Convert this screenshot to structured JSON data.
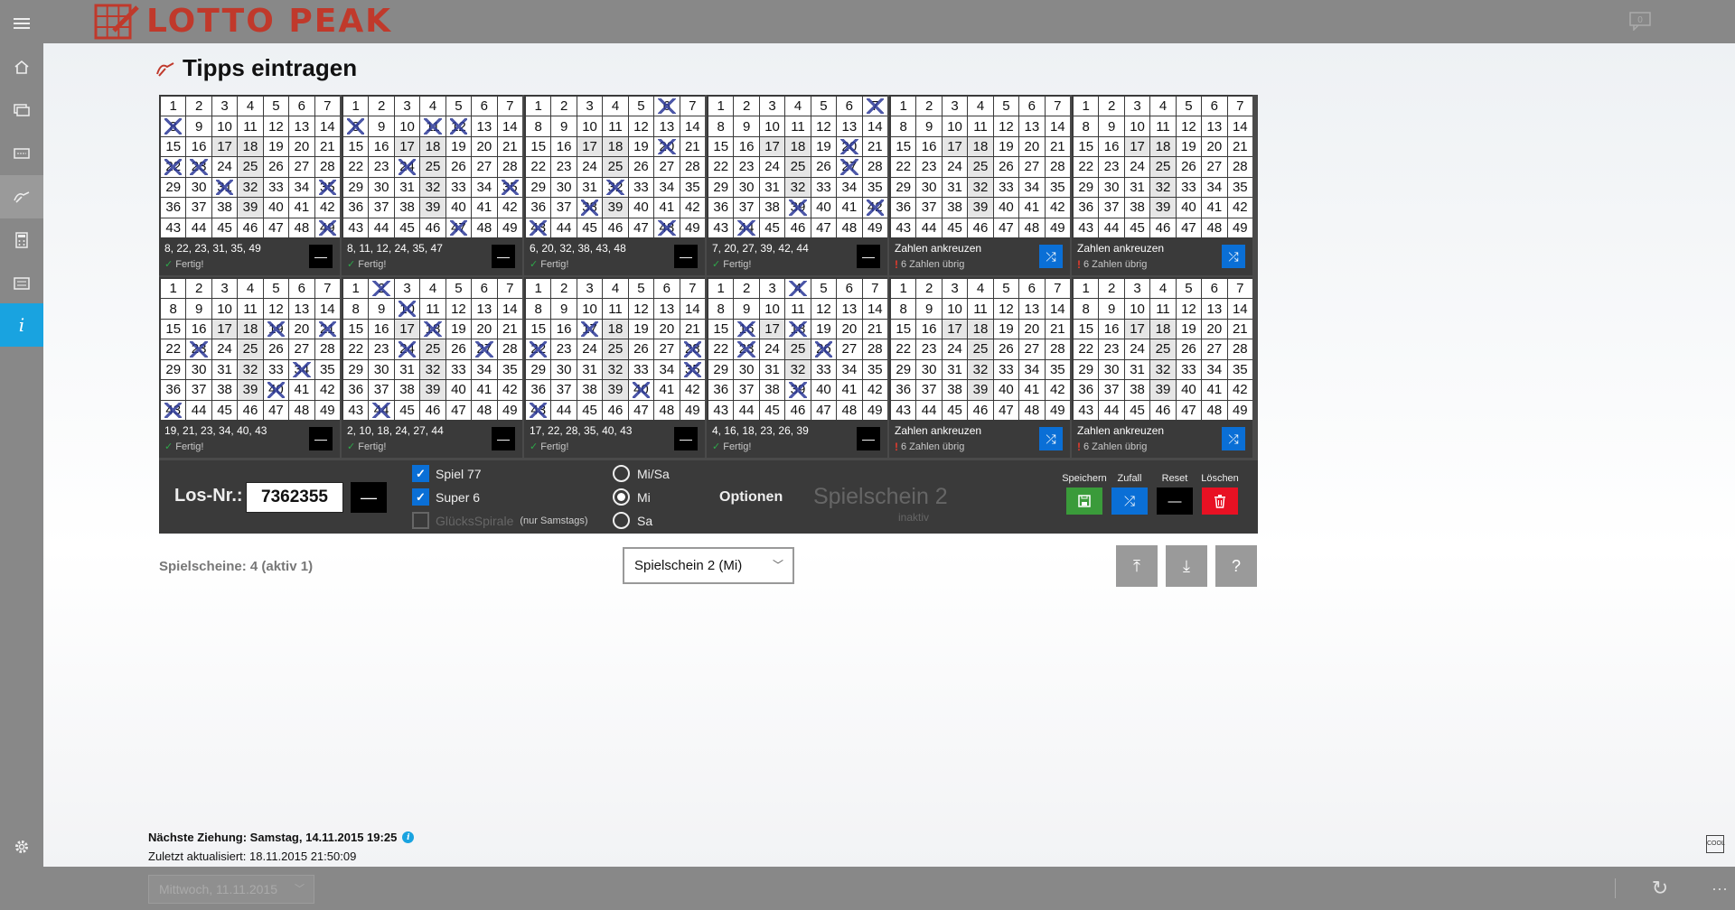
{
  "app": {
    "logo": "LOTTO PEAK",
    "brand_color": "#c0392b",
    "accent_color": "#0a6fd6",
    "info_color": "#19a3e0",
    "message_count": "0"
  },
  "nav": {
    "items": [
      {
        "name": "menu-icon"
      },
      {
        "name": "home-icon"
      },
      {
        "name": "results-icon"
      },
      {
        "name": "ticket-icon"
      },
      {
        "name": "enter-tips-icon",
        "selected": true
      },
      {
        "name": "calculator-icon"
      },
      {
        "name": "statistics-icon"
      },
      {
        "name": "info-icon",
        "active": true
      },
      {
        "name": "settings-icon"
      }
    ]
  },
  "page": {
    "title": "Tipps eintragen"
  },
  "tickets": [
    {
      "numbers": "8, 22, 23, 31, 35, 49",
      "status": "Fertig!",
      "state": "done",
      "picks": [
        8,
        22,
        23,
        31,
        35,
        49
      ]
    },
    {
      "numbers": "8, 11, 12, 24, 35, 47",
      "status": "Fertig!",
      "state": "done",
      "picks": [
        8,
        11,
        12,
        24,
        35,
        47
      ]
    },
    {
      "numbers": "6, 20, 32, 38, 43, 48",
      "status": "Fertig!",
      "state": "done",
      "picks": [
        6,
        20,
        32,
        38,
        43,
        48
      ]
    },
    {
      "numbers": "7, 20, 27, 39, 42, 44",
      "status": "Fertig!",
      "state": "done",
      "picks": [
        7,
        20,
        27,
        39,
        42,
        44
      ]
    },
    {
      "numbers": "Zahlen ankreuzen",
      "status": "6 Zahlen übrig",
      "state": "empty",
      "picks": []
    },
    {
      "numbers": "Zahlen ankreuzen",
      "status": "6 Zahlen übrig",
      "state": "empty",
      "picks": []
    },
    {
      "numbers": "19, 21, 23, 34, 40, 43",
      "status": "Fertig!",
      "state": "done",
      "picks": [
        19,
        21,
        23,
        34,
        40,
        43
      ]
    },
    {
      "numbers": "2, 10, 18, 24, 27, 44",
      "status": "Fertig!",
      "state": "done",
      "picks": [
        2,
        10,
        18,
        24,
        27,
        44
      ]
    },
    {
      "numbers": "17, 22, 28, 35, 40, 43",
      "status": "Fertig!",
      "state": "done",
      "picks": [
        17,
        22,
        28,
        35,
        40,
        43
      ]
    },
    {
      "numbers": "4, 16, 18, 23, 26, 39",
      "status": "Fertig!",
      "state": "done",
      "picks": [
        4,
        16,
        18,
        23,
        26,
        39
      ]
    },
    {
      "numbers": "Zahlen ankreuzen",
      "status": "6 Zahlen übrig",
      "state": "empty",
      "picks": []
    },
    {
      "numbers": "Zahlen ankreuzen",
      "status": "6 Zahlen übrig",
      "state": "empty",
      "picks": []
    }
  ],
  "controls": {
    "losnr_label": "Los-Nr.:",
    "losnr_value": "7362355",
    "spiel77": {
      "label": "Spiel 77",
      "checked": true
    },
    "super6": {
      "label": "Super 6",
      "checked": true
    },
    "gluecksspirale": {
      "label": "GlücksSpirale",
      "note": "(nur Samstags)",
      "checked": false
    },
    "draw_days": [
      {
        "label": "Mi/Sa",
        "selected": false
      },
      {
        "label": "Mi",
        "selected": true
      },
      {
        "label": "Sa",
        "selected": false
      }
    ],
    "options_label": "Optionen",
    "ticket_name": "Spielschein 2",
    "ticket_status": "inaktiv",
    "actions": [
      {
        "label": "Speichern",
        "icon": "save-icon",
        "color": "#3a9b3a"
      },
      {
        "label": "Zufall",
        "icon": "shuffle-icon",
        "color": "#0a6fd6"
      },
      {
        "label": "Reset",
        "icon": "dash-icon",
        "color": "#000000"
      },
      {
        "label": "Löschen",
        "icon": "trash-icon",
        "color": "#e81123"
      }
    ]
  },
  "summary": {
    "count": "Spielscheine: 4 (aktiv 1)",
    "selected_ticket": "Spielschein 2  (Mi)"
  },
  "footer": {
    "next_draw": "Nächste Ziehung: Samstag, 14.11.2015 19:25",
    "updated": "Zuletzt aktualisiert: 18.11.2015 21:50:09",
    "date_value": "Mittwoch, 11.11.2015",
    "cool_badge": "COOL",
    "more": "···"
  }
}
